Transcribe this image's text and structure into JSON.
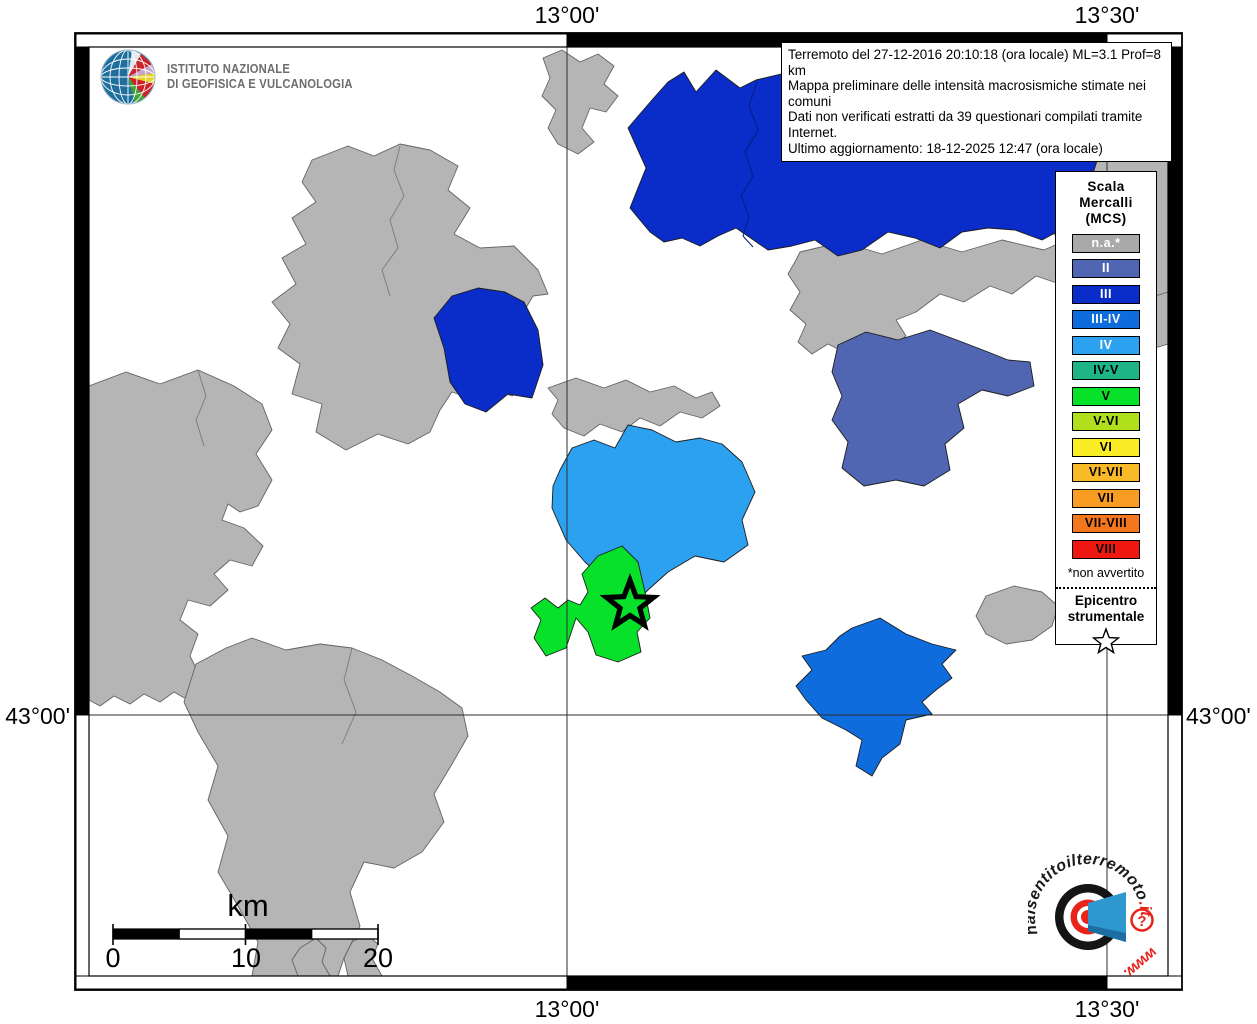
{
  "branding": {
    "institute_line1": "ISTITUTO NAZIONALE",
    "institute_line2": "DI GEOFISICA E VULCANOLOGIA"
  },
  "info_box": {
    "line1": "Terremoto del 27-12-2016 20:10:18 (ora locale) ML=3.1 Prof=8 km",
    "line2": "Mappa preliminare delle intensità macrosismiche stimate nei comuni",
    "line3": "Dati non verificati estratti da 39 questionari compilati tramite Internet.",
    "line4": "Ultimo aggiornamento: 18-12-2025 12:47 (ora locale)"
  },
  "axis_labels": {
    "top_left": "13°00'",
    "top_right": "13°30'",
    "bottom_left": "13°00'",
    "bottom_right": "13°30'",
    "left": "43°00'",
    "right": "43°00'"
  },
  "legend": {
    "title_line1": "Scala",
    "title_line2": "Mercalli",
    "title_line3": "(MCS)",
    "items": [
      {
        "label": "n.a.*",
        "color": "#a9a9a9",
        "text_color": "#ffffff"
      },
      {
        "label": "II",
        "color": "#5066b2",
        "text_color": "#ffffff"
      },
      {
        "label": "III",
        "color": "#0a2cc8",
        "text_color": "#ffffff"
      },
      {
        "label": "III-IV",
        "color": "#0f6cdc",
        "text_color": "#ffffff"
      },
      {
        "label": "IV",
        "color": "#2ba1f0",
        "text_color": "#ffffff"
      },
      {
        "label": "IV-V",
        "color": "#1eb485",
        "text_color": "#000000"
      },
      {
        "label": "V",
        "color": "#07e12a",
        "text_color": "#000000"
      },
      {
        "label": "V-VI",
        "color": "#b0df1b",
        "text_color": "#000000"
      },
      {
        "label": "VI",
        "color": "#f9ee26",
        "text_color": "#000000"
      },
      {
        "label": "VI-VII",
        "color": "#f9ba27",
        "text_color": "#000000"
      },
      {
        "label": "VII",
        "color": "#f99c24",
        "text_color": "#000000"
      },
      {
        "label": "VII-VIII",
        "color": "#f4761d",
        "text_color": "#000000"
      },
      {
        "label": "VIII",
        "color": "#ef1810",
        "text_color": "#000000"
      }
    ],
    "footnote": "*non avvertito",
    "epicenter_line1": "Epicentro",
    "epicenter_line2": "strumentale"
  },
  "scale_bar": {
    "unit": "km",
    "tick0": "0",
    "tick1": "10",
    "tick2": "20"
  },
  "watermark": {
    "site_name": "haisentitoilterremoto",
    "tld": ".it",
    "www": "www.",
    "question_mark": "?"
  },
  "map": {
    "background": "#ffffff",
    "land_color": "#b5b5b5",
    "regions": [
      {
        "id": "north-large",
        "intensity": "III"
      },
      {
        "id": "west-single",
        "intensity": "III"
      },
      {
        "id": "east-mid",
        "intensity": "II"
      },
      {
        "id": "center-large",
        "intensity": "IV"
      },
      {
        "id": "epicenter-area",
        "intensity": "V"
      },
      {
        "id": "south-east",
        "intensity": "III-IV"
      }
    ]
  }
}
